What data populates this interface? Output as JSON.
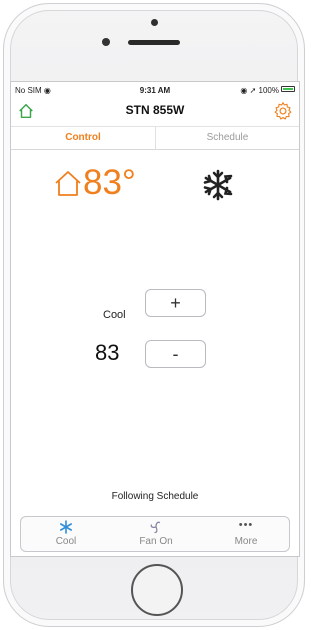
{
  "status_bar": {
    "carrier": "No SIM",
    "time": "9:31 AM",
    "battery": "100%",
    "battery_level": 1.0
  },
  "nav": {
    "title": "STN 855W",
    "home_icon": "home-icon",
    "settings_icon": "gear-icon"
  },
  "tabs": {
    "control": "Control",
    "schedule": "Schedule"
  },
  "thermostat": {
    "current_temp": "83°",
    "mode_label": "Cool",
    "setpoint": "83",
    "increase_label": "+",
    "decrease_label": "-",
    "schedule_status": "Following Schedule"
  },
  "bottom_bar": {
    "cool_label": "Cool",
    "fan_label": "Fan On",
    "more_label": "More",
    "more_dots": "•••"
  },
  "colors": {
    "accent_orange": "#f07f1d",
    "cool_blue": "#2f8fd8",
    "green_home": "#3aa648"
  }
}
